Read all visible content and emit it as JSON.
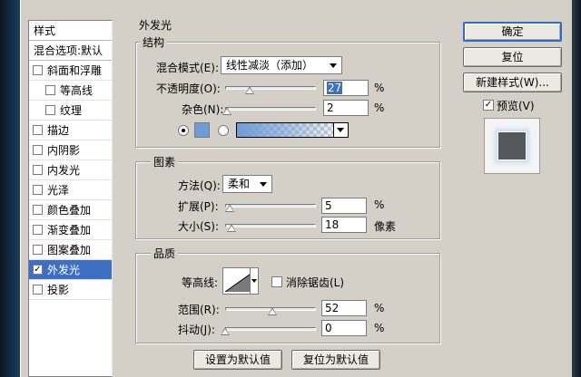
{
  "colors": {
    "dialog_bg": "#d4d0c8",
    "selection": "#3d6fc2",
    "glow_color": "#6f9cd4",
    "preview_square": "#54575b"
  },
  "left_panel": {
    "header": "样式",
    "blend_options": "混合选项:默认",
    "items": [
      {
        "label": "斜面和浮雕",
        "checked": false,
        "indent": false
      },
      {
        "label": "等高线",
        "checked": false,
        "indent": true
      },
      {
        "label": "纹理",
        "checked": false,
        "indent": true
      },
      {
        "label": "描边",
        "checked": false,
        "indent": false
      },
      {
        "label": "内阴影",
        "checked": false,
        "indent": false
      },
      {
        "label": "内发光",
        "checked": false,
        "indent": false
      },
      {
        "label": "光泽",
        "checked": false,
        "indent": false
      },
      {
        "label": "颜色叠加",
        "checked": false,
        "indent": false
      },
      {
        "label": "渐变叠加",
        "checked": false,
        "indent": false
      },
      {
        "label": "图案叠加",
        "checked": false,
        "indent": false
      },
      {
        "label": "外发光",
        "checked": true,
        "indent": false,
        "selected": true
      },
      {
        "label": "投影",
        "checked": false,
        "indent": false
      }
    ]
  },
  "main": {
    "section_title": "外发光",
    "structure": {
      "title": "结构",
      "blend_mode_label": "混合模式(E):",
      "blend_mode_value": "线性减淡（添加）",
      "opacity_label": "不透明度(O):",
      "opacity_value": "27",
      "opacity_unit": "%",
      "opacity_fraction": 0.27,
      "noise_label": "杂色(N):",
      "noise_value": "2",
      "noise_unit": "%",
      "noise_fraction": 0.02
    },
    "elements": {
      "title": "图素",
      "technique_label": "方法(Q):",
      "technique_value": "柔和",
      "spread_label": "扩展(P):",
      "spread_value": "5",
      "spread_unit": "%",
      "spread_fraction": 0.05,
      "size_label": "大小(S):",
      "size_value": "18",
      "size_unit": "像素",
      "size_fraction": 0.072
    },
    "quality": {
      "title": "品质",
      "contour_label": "等高线:",
      "antialias_label": "消除锯齿(L)",
      "antialias_checked": false,
      "range_label": "范围(R):",
      "range_value": "52",
      "range_unit": "%",
      "range_fraction": 0.52,
      "jitter_label": "抖动(J):",
      "jitter_value": "0",
      "jitter_unit": "%",
      "jitter_fraction": 0.0
    },
    "make_default_label": "设置为默认值",
    "reset_default_label": "复位为默认值"
  },
  "right_panel": {
    "ok_label": "确定",
    "reset_label": "复位",
    "new_style_label": "新建样式(W)...",
    "preview_label": "预览(V)",
    "preview_checked": true
  }
}
